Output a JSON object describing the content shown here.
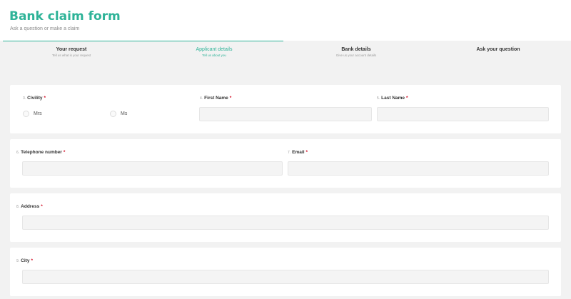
{
  "header": {
    "title": "Bank claim form",
    "subtitle": "Ask a question or make a claim"
  },
  "steps": [
    {
      "title": "Your request",
      "subtitle": "Tell us what is your request"
    },
    {
      "title": "Applicant details",
      "subtitle": "Tell us about you"
    },
    {
      "title": "Bank details",
      "subtitle": "Give us your account details"
    },
    {
      "title": "Ask your question",
      "subtitle": ""
    }
  ],
  "form": {
    "civility": {
      "number": "3.",
      "label": "Civility",
      "required": "*",
      "options": [
        "Mrs",
        "Ms"
      ]
    },
    "first_name": {
      "number": "4.",
      "label": "First Name",
      "required": "*",
      "value": ""
    },
    "last_name": {
      "number": "5.",
      "label": "Last Name",
      "required": "*",
      "value": ""
    },
    "telephone": {
      "number": "6.",
      "label": "Telephone number",
      "required": "*",
      "value": ""
    },
    "email": {
      "number": "7.",
      "label": "Email",
      "required": "*",
      "value": ""
    },
    "address": {
      "number": "8.",
      "label": "Address",
      "required": "*",
      "value": ""
    },
    "city": {
      "number": "9.",
      "label": "City",
      "required": "*",
      "value": ""
    }
  },
  "colors": {
    "accent": "#2eb398",
    "required": "#d0021b",
    "background": "#f2f2f2"
  }
}
